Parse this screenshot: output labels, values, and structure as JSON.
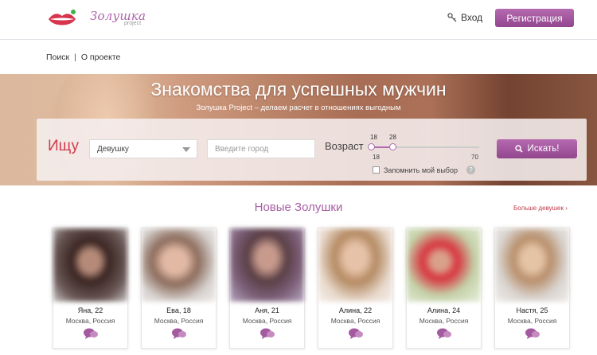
{
  "header": {
    "logo_text": "Золушка",
    "logo_sub": "project",
    "login_label": "Вход",
    "register_label": "Регистрация"
  },
  "breadcrumbs": [
    "Поиск",
    "О проекте"
  ],
  "hero": {
    "title": "Знакомства для успешных мужчин",
    "subtitle": "Золушка Project – делаем расчет в отношениях выгодным"
  },
  "search": {
    "seek_label": "Ищу",
    "gender_value": "Девушку",
    "city_placeholder": "Введите город",
    "age_label": "Возраст",
    "age_selected_min": "18",
    "age_selected_max": "28",
    "age_range_min": "18",
    "age_range_max": "70",
    "remember_label": "Запомнить мой выбор",
    "help_text": "?",
    "search_button": "Искать!"
  },
  "new_section": {
    "title": "Новые Золушки",
    "more_link": "Больше девушек ›"
  },
  "profiles": [
    {
      "name": "Яна, 22",
      "location": "Москва, Россия"
    },
    {
      "name": "Ева, 18",
      "location": "Москва, Россия"
    },
    {
      "name": "Аня, 21",
      "location": "Москва, Россия"
    },
    {
      "name": "Алина, 22",
      "location": "Москва, Россия"
    },
    {
      "name": "Алина, 24",
      "location": "Москва, Россия"
    },
    {
      "name": "Настя, 25",
      "location": "Москва, Россия"
    }
  ],
  "colors": {
    "brand_purple": "#a35a9f",
    "accent_red": "#d03c4c"
  },
  "icons": {
    "logo": "lips-icon",
    "login": "key-icon",
    "search": "magnifier-icon",
    "chat": "chat-bubbles-icon"
  }
}
